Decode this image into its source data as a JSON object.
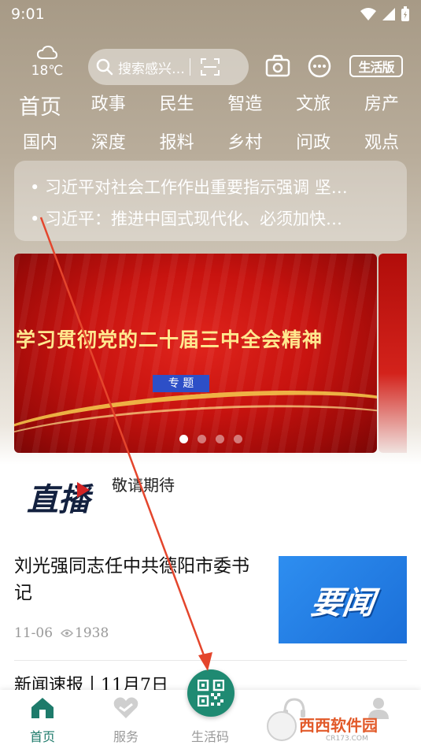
{
  "status_bar": {
    "time": "9:01"
  },
  "weather": {
    "temp": "18℃",
    "icon": "cloud-icon"
  },
  "search": {
    "placeholder": "搜索感兴…",
    "icon": "search-icon",
    "scan_icon": "scan-icon"
  },
  "top_actions": {
    "camera_icon": "camera-icon",
    "chat_icon": "chat-icon",
    "life_label": "生活版"
  },
  "nav": {
    "row1": [
      "首页",
      "政事",
      "民生",
      "智造",
      "文旅",
      "房产"
    ],
    "row2": [
      "国内",
      "深度",
      "报料",
      "乡村",
      "问政",
      "观点"
    ],
    "active": "首页"
  },
  "headlines": [
    "• 习近平对社会工作作出重要指示强调 坚…",
    "• 习近平：推进中国式现代化、必须加快…"
  ],
  "banner": {
    "title": "学习贯彻党的二十届三中全会精神",
    "tag": "专 题",
    "dots": 4,
    "active_dot": 0
  },
  "live": {
    "logo_text": "直播",
    "text": "敬请期待"
  },
  "news": [
    {
      "title": "刘光强同志任中共德阳市委书记",
      "date": "11-06",
      "views": "1938",
      "thumb_text": "要闻"
    }
  ],
  "news_brief": {
    "title": "新闻速报",
    "date": "11月7日"
  },
  "tabs": [
    {
      "label": "首页",
      "icon": "home-icon",
      "active": true
    },
    {
      "label": "服务",
      "icon": "service-icon",
      "active": false
    },
    {
      "label": "生活码",
      "icon": "qr-code-icon",
      "active": false
    },
    {
      "label": "",
      "icon": "headset-icon",
      "active": false
    },
    {
      "label": "",
      "icon": "profile-icon",
      "active": false
    }
  ],
  "watermark": {
    "text": "西西软件园",
    "subtext": "CR173.COM"
  },
  "colors": {
    "accent": "#1e7b6b",
    "banner_red": "#c8130f",
    "thumb_blue": "#2e8ef0",
    "annotation": "#e4452c"
  }
}
